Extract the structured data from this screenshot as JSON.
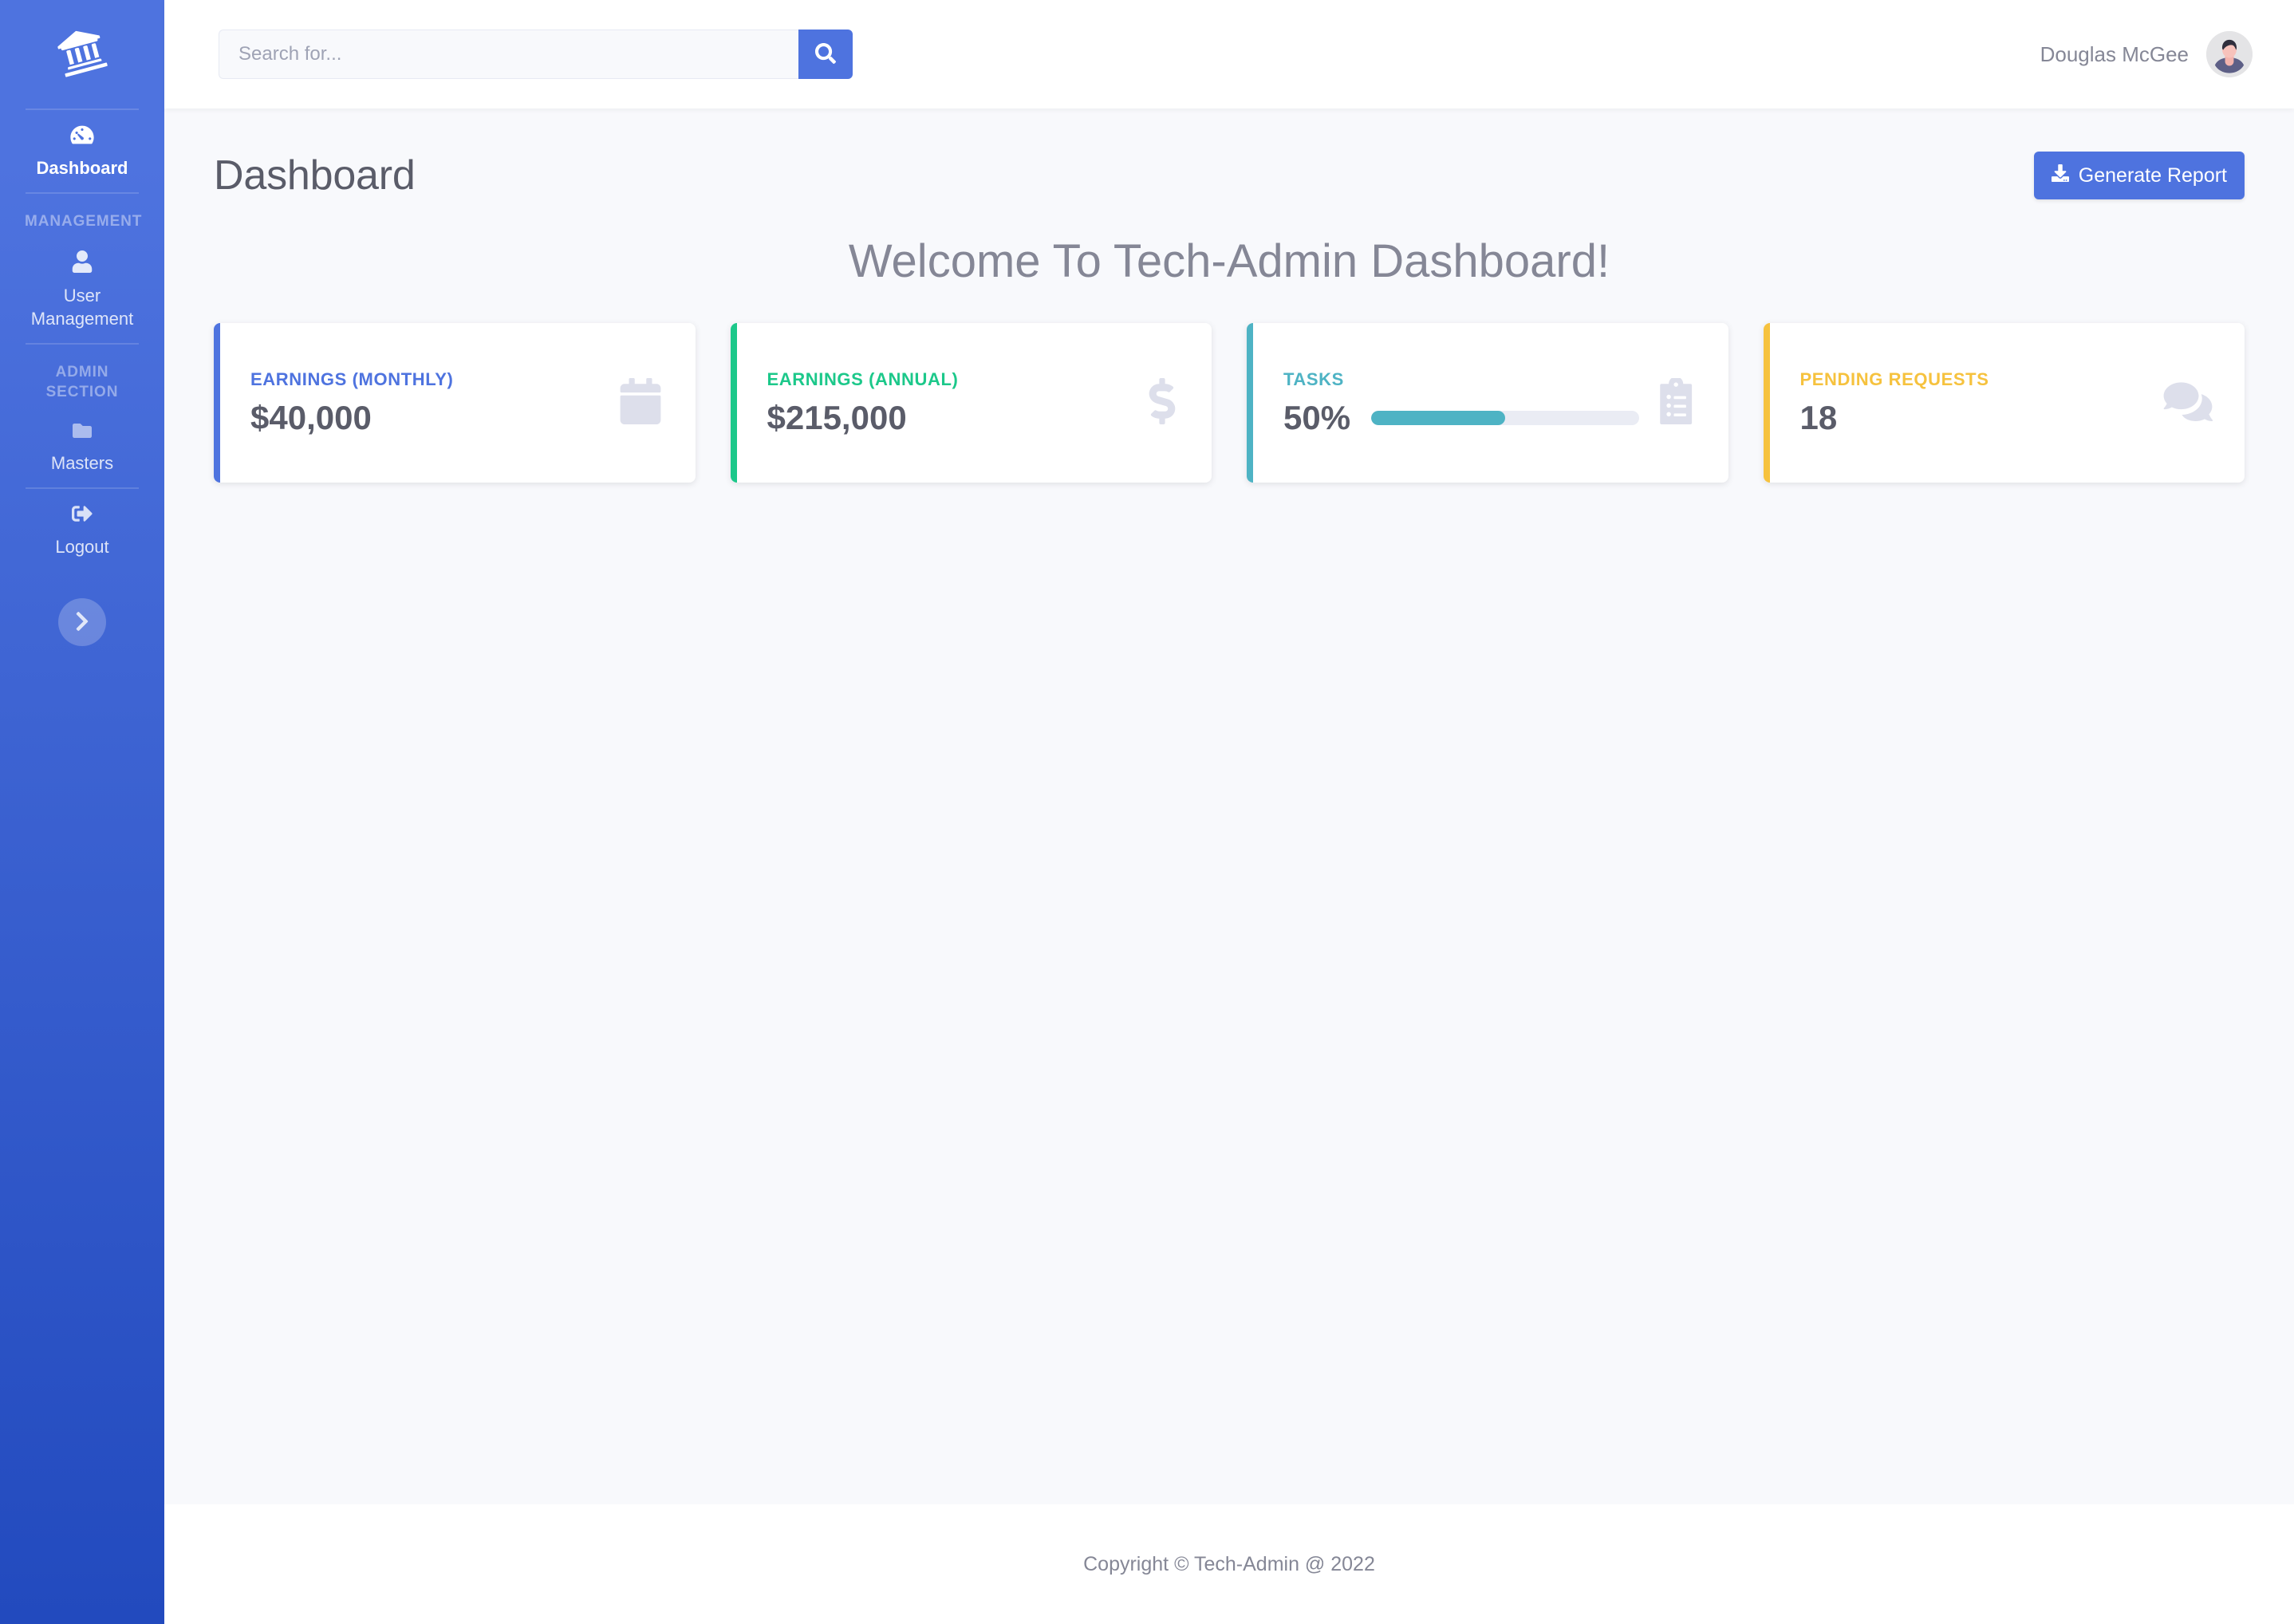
{
  "sidebar": {
    "brand_icon": "university-icon",
    "items": [
      {
        "label": "Dashboard",
        "icon": "tachometer-icon",
        "active": true
      },
      {
        "label": "User Management",
        "icon": "user-icon",
        "active": false
      },
      {
        "label": "Masters",
        "icon": "folder-icon",
        "active": false
      },
      {
        "label": "Logout",
        "icon": "sign-out-icon",
        "active": false
      }
    ],
    "headings": {
      "management": "MANAGEMENT",
      "admin_section": "ADMIN SECTION"
    },
    "toggle_icon": "chevron-right-icon",
    "accent": "#4e73df"
  },
  "topbar": {
    "search": {
      "placeholder": "Search for...",
      "value": "",
      "button_icon": "search-icon"
    },
    "user": {
      "name": "Douglas McGee",
      "avatar": "user-avatar"
    }
  },
  "page": {
    "title": "Dashboard",
    "generate_report_label": "Generate Report",
    "generate_report_icon": "download-icon",
    "welcome": "Welcome To Tech-Admin Dashboard!"
  },
  "cards": [
    {
      "label": "EARNINGS (MONTHLY)",
      "value": "$40,000",
      "accent": "#4e73df",
      "icon": "calendar-icon",
      "progress": null
    },
    {
      "label": "EARNINGS (ANNUAL)",
      "value": "$215,000",
      "accent": "#1cc88a",
      "icon": "dollar-icon",
      "progress": null
    },
    {
      "label": "TASKS",
      "value": "50%",
      "accent": "#4eb3c4",
      "icon": "clipboard-list-icon",
      "progress": 50
    },
    {
      "label": "PENDING REQUESTS",
      "value": "18",
      "accent": "#f6c23e",
      "icon": "comments-icon",
      "progress": null
    }
  ],
  "footer": {
    "copyright": "Copyright © Tech-Admin @ 2022"
  }
}
